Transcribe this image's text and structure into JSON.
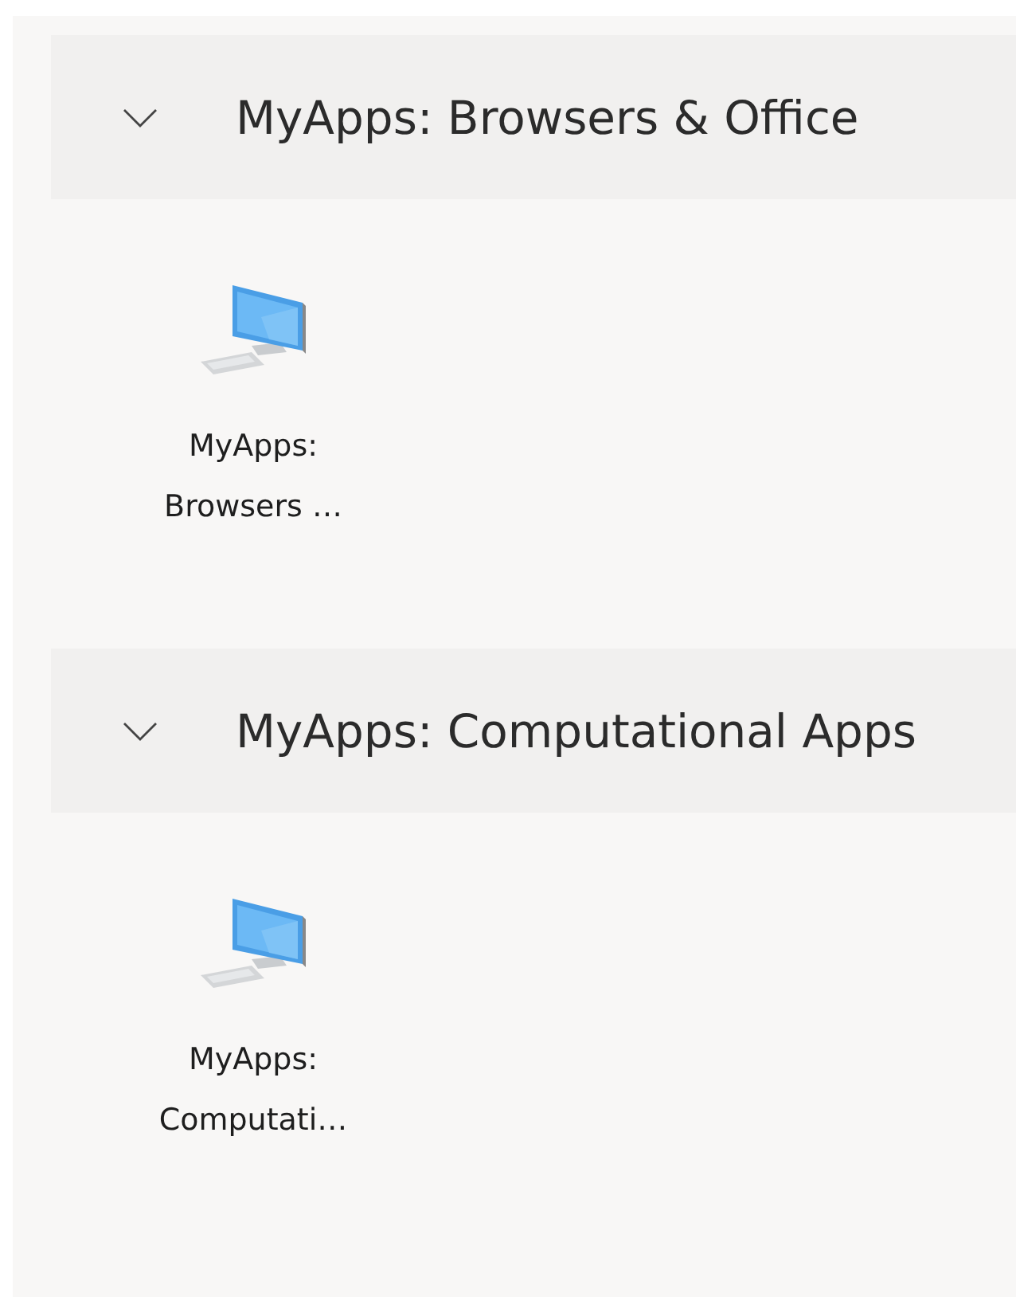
{
  "groups": [
    {
      "title": "MyApps: Browsers & Office",
      "expanded": true,
      "items": [
        {
          "label": "MyApps: Browsers …"
        }
      ]
    },
    {
      "title": "MyApps: Computational Apps",
      "expanded": true,
      "items": [
        {
          "label": "MyApps: Computati…"
        }
      ]
    }
  ]
}
